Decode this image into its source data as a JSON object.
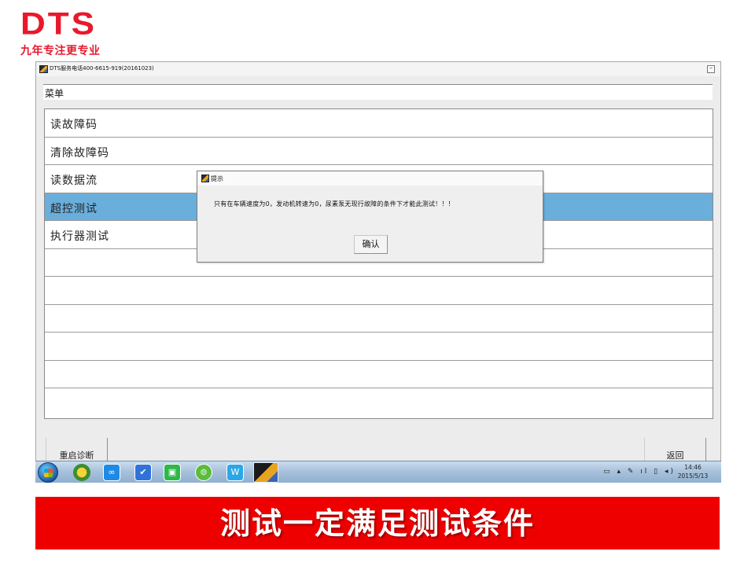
{
  "brand": {
    "logo_text": "DTS",
    "slogan": "九年专注更专业",
    "color": "#e8192c"
  },
  "window": {
    "title": "DTS服务电话400-6615-919(20161023)",
    "minimize_label": "–"
  },
  "menu": {
    "header": "菜单",
    "items": [
      {
        "label": "读故障码"
      },
      {
        "label": "清除故障码"
      },
      {
        "label": "读数据流"
      },
      {
        "label": "超控测试",
        "selected": true
      },
      {
        "label": "执行器测试"
      },
      {
        "label": ""
      },
      {
        "label": ""
      },
      {
        "label": ""
      },
      {
        "label": ""
      },
      {
        "label": ""
      },
      {
        "label": ""
      }
    ],
    "selected_color": "#6aaedc"
  },
  "bottom_buttons": {
    "restart": "重启诊断",
    "back": "返回"
  },
  "dialog": {
    "title": "提示",
    "message": "只有在车辆速度为0，发动机转速为0，尿素泵无现行故障的条件下才能此测试！！！",
    "ok_label": "确认"
  },
  "taskbar": {
    "icons": [
      "start-orb-icon",
      "app-icon-1",
      "cloud-app-icon",
      "app-icon-3",
      "iqiyi-icon",
      "browser-icon",
      "wps-writer-icon",
      "dts-app-icon"
    ],
    "tray": "▭ ▴ ✎ ıl ▯ ◂)",
    "time": "14:46",
    "date": "2015/5/13"
  },
  "banner": {
    "text": "测试一定满足测试条件",
    "color": "#ee0000"
  }
}
